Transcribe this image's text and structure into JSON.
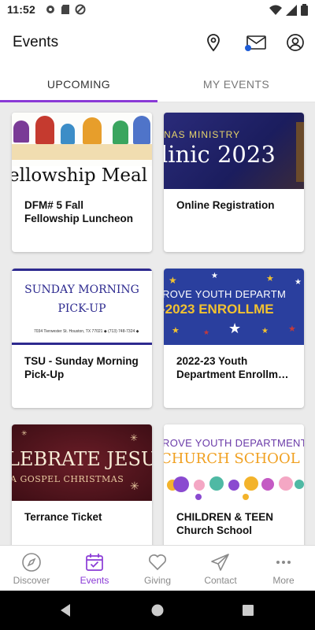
{
  "status_bar": {
    "time": "11:52"
  },
  "app_bar": {
    "title": "Events"
  },
  "tabs": [
    {
      "label": "UPCOMING",
      "active": true
    },
    {
      "label": "MY EVENTS",
      "active": false
    }
  ],
  "events": [
    {
      "title": "DFM# 5 Fall Fellowship Luncheon",
      "image_text": "ellowship Meal"
    },
    {
      "title": "Online Registration",
      "image_text_top": "NAS MINISTRY",
      "image_text_main": "linic 2023"
    },
    {
      "title": "TSU - Sunday Morning Pick-Up",
      "image_text_line1": "SUNDAY MORNING",
      "image_text_line2": "PICK-UP",
      "image_text_small": "7034 Tierwester St. Houston, TX 77021 ◆ (713) 748-7324 ◆"
    },
    {
      "title": "2022-23 Youth Department Enrollm…",
      "image_text_top": "ROVE YOUTH DEPARTM",
      "image_text_main": "-2023 ENROLLME"
    },
    {
      "title": "Terrance Ticket",
      "image_text_main": "LEBRATE JESUS",
      "image_text_sub": "A GOSPEL CHRISTMAS"
    },
    {
      "title": "CHILDREN & TEEN Church School",
      "image_text_top": "ROVE YOUTH DEPARTMENT",
      "image_text_main": "CHURCH SCHOOL FO"
    }
  ],
  "bottom_nav": [
    {
      "label": "Discover",
      "icon": "compass-icon",
      "active": false
    },
    {
      "label": "Events",
      "icon": "calendar-check-icon",
      "active": true
    },
    {
      "label": "Giving",
      "icon": "heart-icon",
      "active": false
    },
    {
      "label": "Contact",
      "icon": "paper-plane-icon",
      "active": false
    },
    {
      "label": "More",
      "icon": "more-dots-icon",
      "active": false
    }
  ],
  "colors": {
    "accent": "#8a3ad6",
    "inactive": "#8a8a8a",
    "background": "#ebebeb"
  }
}
